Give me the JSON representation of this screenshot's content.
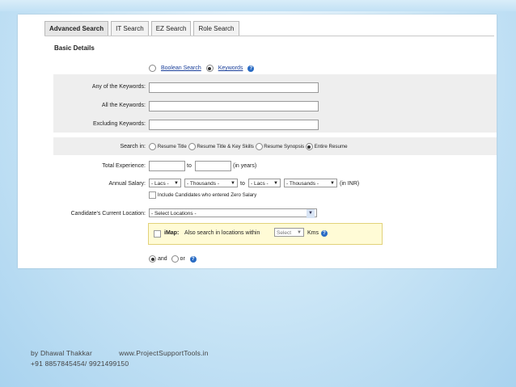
{
  "tabs": [
    "Advanced Search",
    "IT Search",
    "EZ Search",
    "Role Search"
  ],
  "section_title": "Basic Details",
  "search_mode": {
    "boolean": "Boolean Search",
    "keywords": "Keywords",
    "selected": "keywords"
  },
  "keywords": {
    "any_label": "Any of the Keywords:",
    "all_label": "All the Keywords:",
    "excluding_label": "Excluding Keywords:"
  },
  "search_in": {
    "label": "Search in:",
    "options": [
      "Resume Title",
      "Resume Title & Key Skills",
      "Resume Synopsis",
      "Entire Resume"
    ],
    "selected": "Entire Resume"
  },
  "experience": {
    "label": "Total Experience:",
    "to": "to",
    "unit": "(in years)"
  },
  "salary": {
    "label": "Annual Salary:",
    "lacs": "- Lacs -",
    "thousands": "- Thousands -",
    "to": "to",
    "unit": "(in INR)",
    "zero_salary": "Include Candidates who entered Zero Salary"
  },
  "location": {
    "label": "Candidate's Current Location:",
    "value": "- Select Locations -"
  },
  "imap": {
    "title": "iMap:",
    "text": "Also search in locations within",
    "select": "Select",
    "unit": "Kms"
  },
  "and_or": {
    "and": "and",
    "or": "or",
    "selected": "and"
  },
  "footer": {
    "author": "by Dhawal Thakkar",
    "website": "www.ProjectSupportTools.in",
    "phones": "+91 8857845454/  9921499150"
  }
}
